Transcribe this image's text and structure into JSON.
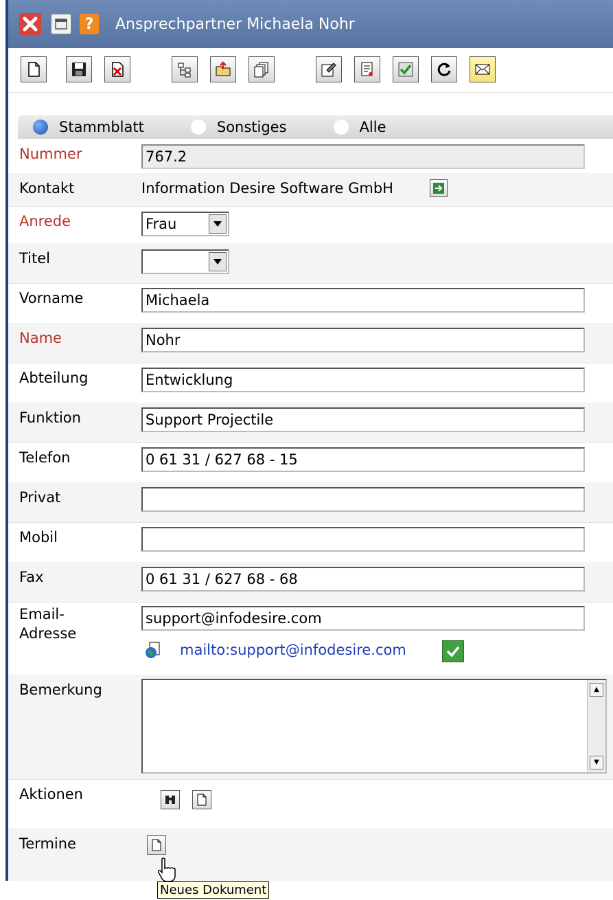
{
  "window": {
    "title": "Ansprechpartner Michaela Nohr"
  },
  "toolbar": {
    "buttons": [
      "new-document",
      "save",
      "delete",
      "tree",
      "folder-upload",
      "copy",
      "properties",
      "report",
      "check",
      "refresh",
      "email"
    ]
  },
  "tabs": [
    {
      "label": "Stammblatt",
      "active": true
    },
    {
      "label": "Sonstiges",
      "active": false
    },
    {
      "label": "Alle",
      "active": false
    }
  ],
  "form": {
    "nummer": {
      "label": "Nummer",
      "value": "767.2"
    },
    "kontakt": {
      "label": "Kontakt",
      "value": "Information Desire Software GmbH"
    },
    "anrede": {
      "label": "Anrede",
      "value": "Frau"
    },
    "titel": {
      "label": "Titel",
      "value": ""
    },
    "vorname": {
      "label": "Vorname",
      "value": "Michaela"
    },
    "name": {
      "label": "Name",
      "value": "Nohr"
    },
    "abteilung": {
      "label": "Abteilung",
      "value": "Entwicklung"
    },
    "funktion": {
      "label": "Funktion",
      "value": "Support Projectile"
    },
    "telefon": {
      "label": "Telefon",
      "value": "0 61 31 / 627 68 - 15"
    },
    "privat": {
      "label": "Privat",
      "value": ""
    },
    "mobil": {
      "label": "Mobil",
      "value": ""
    },
    "fax": {
      "label": "Fax",
      "value": "0 61 31 / 627 68 - 68"
    },
    "email": {
      "label_line1": "Email-",
      "label_line2": "Adresse",
      "value": "support@infodesire.com",
      "link": "mailto:support@infodesire.com"
    },
    "bemerkung": {
      "label": "Bemerkung",
      "value": ""
    },
    "aktionen": {
      "label": "Aktionen"
    },
    "termine": {
      "label": "Termine"
    }
  },
  "tooltip": "Neues Dokument",
  "colors": {
    "title_bar": "#5f7cab",
    "required_label": "#b8342a",
    "link": "#1f3fb8"
  }
}
